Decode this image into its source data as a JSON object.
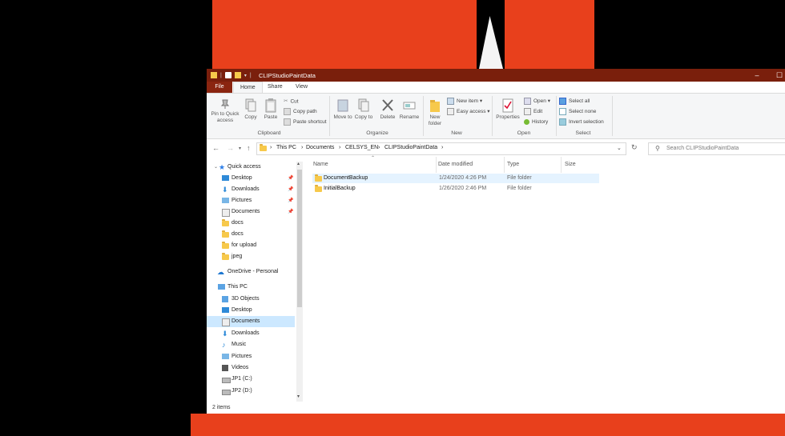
{
  "window": {
    "title": "CLIPStudioPaintData",
    "minimize": "–",
    "maximize": "☐"
  },
  "ribbon_tabs": {
    "file": "File",
    "home": "Home",
    "share": "Share",
    "view": "View"
  },
  "ribbon": {
    "pin_to_quick_access": "Pin to Quick access",
    "copy": "Copy",
    "paste": "Paste",
    "cut": "Cut",
    "copy_path": "Copy path",
    "paste_shortcut": "Paste shortcut",
    "clipboard_group": "Clipboard",
    "move_to": "Move to",
    "copy_to": "Copy to",
    "delete": "Delete",
    "rename": "Rename",
    "organize_group": "Organize",
    "new_folder": "New folder",
    "new_item": "New item",
    "easy_access": "Easy access",
    "new_group": "New",
    "properties": "Properties",
    "open": "Open",
    "edit": "Edit",
    "history": "History",
    "open_group": "Open",
    "select_all": "Select all",
    "select_none": "Select none",
    "invert_selection": "Invert selection",
    "select_group": "Select"
  },
  "address": {
    "crumbs": [
      "This PC",
      "Documents",
      "CELSYS_EN",
      "CLIPStudioPaintData"
    ],
    "separator": "›",
    "search_placeholder": "Search CLIPStudioPaintData"
  },
  "sidebar": {
    "quick_access": "Quick access",
    "items": [
      "Desktop",
      "Downloads",
      "Pictures",
      "Documents",
      "docs",
      "docs",
      "for upload",
      "jpeg"
    ],
    "onedrive": "OneDrive - Personal",
    "this_pc": "This PC",
    "pc_items": [
      "3D Objects",
      "Desktop",
      "Documents",
      "Downloads",
      "Music",
      "Pictures",
      "Videos",
      "JP1 (C:)",
      "JP2 (D:)"
    ]
  },
  "columns": {
    "name": "Name",
    "date": "Date modified",
    "type": "Type",
    "size": "Size"
  },
  "files": [
    {
      "name": "DocumentBackup",
      "date": "1/24/2020 4:26 PM",
      "type": "File folder"
    },
    {
      "name": "InitialBackup",
      "date": "1/26/2020 2:46 PM",
      "type": "File folder"
    }
  ],
  "status": {
    "count": "2 items"
  },
  "colors": {
    "titlebar": "#7a1f0c",
    "background_red": "#e8401c",
    "selection": "#cce8ff",
    "accent": "#0078d7"
  }
}
